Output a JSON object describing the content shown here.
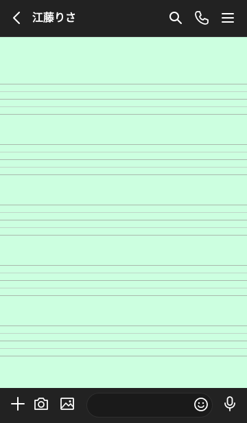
{
  "header": {
    "contact_name": "江藤りさ"
  },
  "icons": {
    "back": "chevron-left-icon",
    "search": "search-icon",
    "phone": "phone-icon",
    "menu": "hamburger-menu-icon",
    "plus": "plus-icon",
    "camera": "camera-icon",
    "image": "image-icon",
    "emoji": "emoji-icon",
    "mic": "microphone-icon"
  },
  "colors": {
    "bar_background": "#222222",
    "chat_background": "#ccffe0",
    "staff_line_dark": "#a9b9ad",
    "staff_line_light": "#bfd6c8"
  },
  "message_input": {
    "value": "",
    "placeholder": ""
  }
}
